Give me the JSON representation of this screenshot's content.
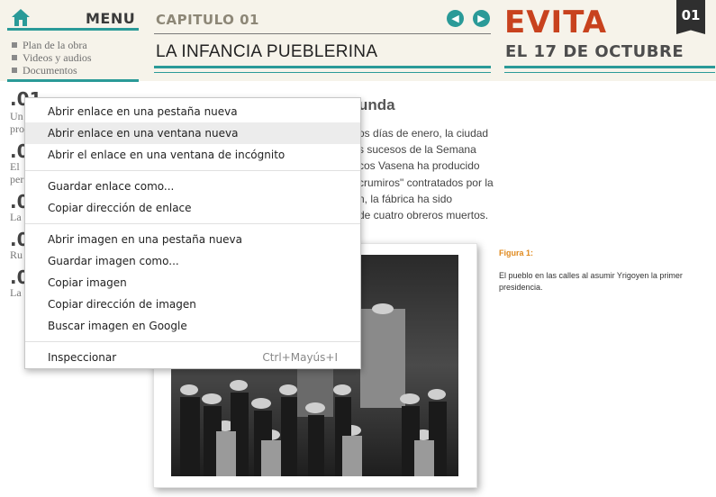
{
  "nav": {
    "menu_label": "MENU",
    "links": [
      "Plan de la obra",
      "Videos y audios",
      "Documentos"
    ]
  },
  "chapter": {
    "label": "CAPITULO 01",
    "title": "LA INFANCIA PUEBLERINA",
    "badge": "01"
  },
  "brand": {
    "title": "EVITA",
    "subtitle": "EL 17 DE OCTUBRE"
  },
  "left_items": [
    {
      "num": ".01",
      "text": "Un"
    },
    {
      "num": ".0",
      "text": "pro"
    },
    {
      "num": ".0",
      "text": "El"
    },
    {
      "num": "",
      "text": "per"
    },
    {
      "num": ".0",
      "text": "La"
    },
    {
      "num": ".0",
      "text": "Ru"
    },
    {
      "num": ".0",
      "text": "La"
    }
  ],
  "article": {
    "heading": "unda",
    "lines": [
      "os días de enero, la ciudad",
      "s sucesos de la Semana",
      "cos Vasena ha producido",
      "crumiros\" contratados por la",
      "n, la fábrica ha sido",
      "de cuatro obreros muertos."
    ]
  },
  "figure": {
    "label": "Figura 1:",
    "caption": "El pueblo en las calles al asumir Yrigoyen la primer presidencia."
  },
  "context_menu": {
    "groups": [
      [
        {
          "label": "Abrir enlace en una pestaña nueva"
        },
        {
          "label": "Abrir enlace en una ventana nueva"
        },
        {
          "label": "Abrir el enlace en una ventana de incógnito"
        }
      ],
      [
        {
          "label": "Guardar enlace como..."
        },
        {
          "label": "Copiar dirección de enlace"
        }
      ],
      [
        {
          "label": "Abrir imagen en una pestaña nueva"
        },
        {
          "label": "Guardar imagen como..."
        },
        {
          "label": "Copiar imagen"
        },
        {
          "label": "Copiar dirección de imagen"
        },
        {
          "label": "Buscar imagen en Google"
        }
      ],
      [
        {
          "label": "Inspeccionar",
          "shortcut": "Ctrl+Mayús+I"
        }
      ]
    ]
  },
  "colors": {
    "accent_teal": "#2a9a98",
    "brand_red": "#c8421e",
    "figure_orange": "#e08a1e"
  },
  "icons": {
    "home": "home-icon",
    "prev": "arrow-left-icon",
    "next": "arrow-right-icon"
  }
}
